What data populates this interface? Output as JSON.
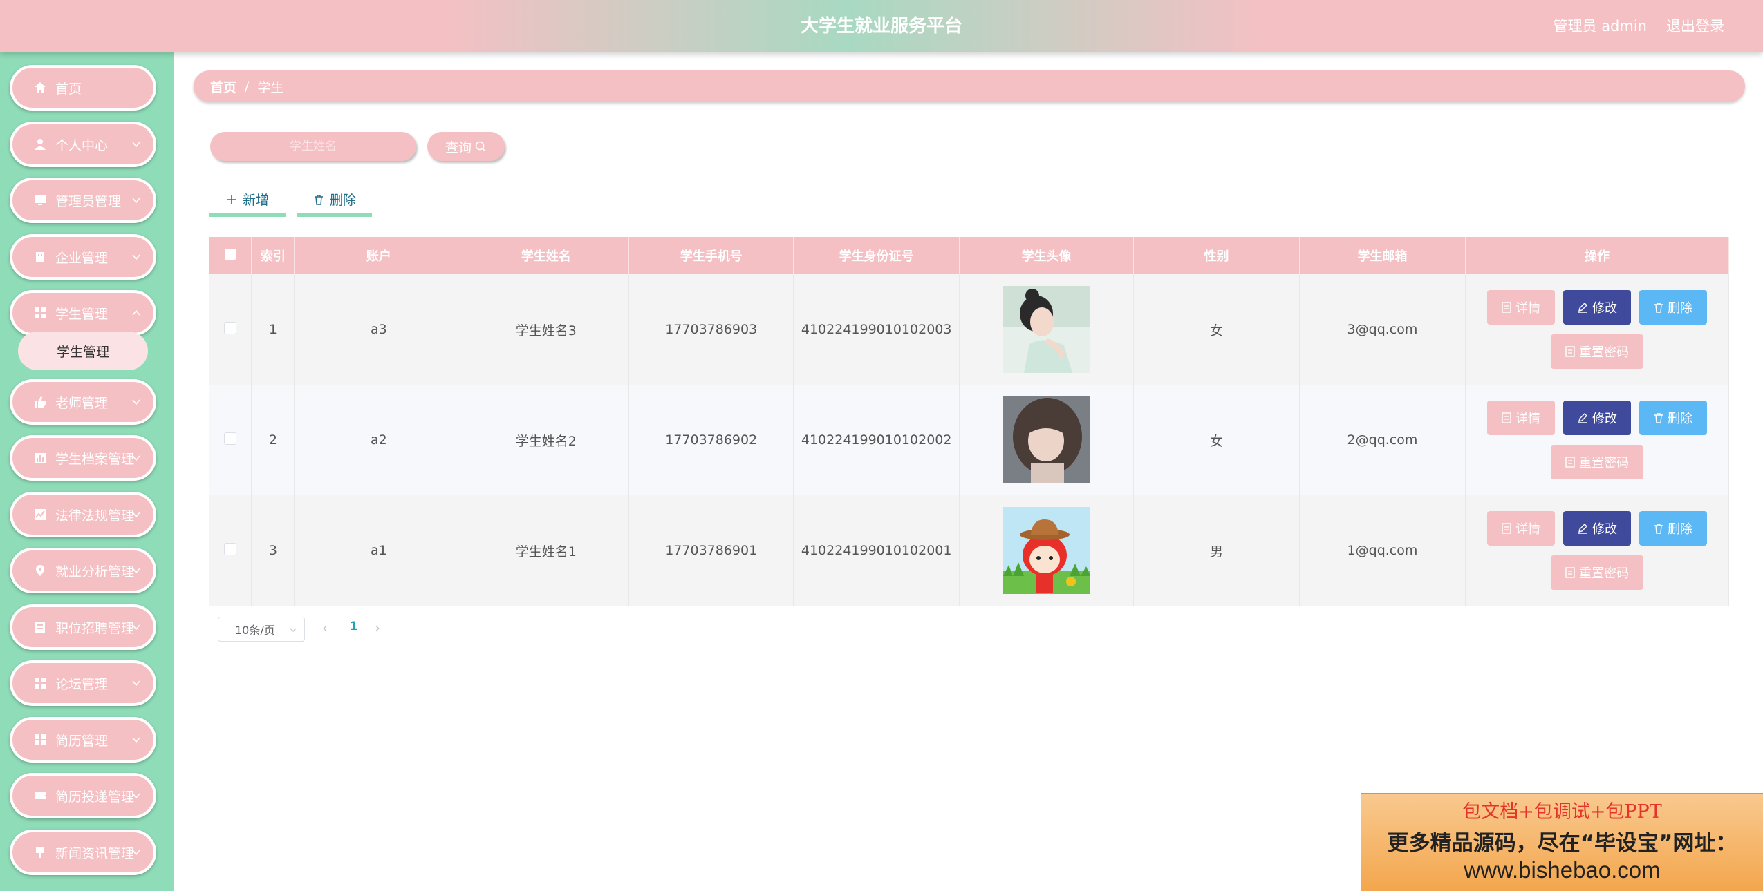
{
  "header": {
    "title": "大学生就业服务平台",
    "user": "管理员 admin",
    "logout": "退出登录"
  },
  "sidebar": {
    "items": [
      {
        "label": "首页",
        "icon": "home-icon"
      },
      {
        "label": "个人中心",
        "icon": "user-icon"
      },
      {
        "label": "管理员管理",
        "icon": "monitor-icon"
      },
      {
        "label": "企业管理",
        "icon": "building-icon"
      },
      {
        "label": "学生管理",
        "icon": "grid-icon"
      },
      {
        "label": "老师管理",
        "icon": "thumb-icon"
      },
      {
        "label": "学生档案管理",
        "icon": "chart-icon"
      },
      {
        "label": "法律法规管理",
        "icon": "trend-icon"
      },
      {
        "label": "就业分析管理",
        "icon": "location-icon"
      },
      {
        "label": "职位招聘管理",
        "icon": "list-icon"
      },
      {
        "label": "论坛管理",
        "icon": "grid-icon"
      },
      {
        "label": "简历管理",
        "icon": "grid-icon"
      },
      {
        "label": "简历投递管理",
        "icon": "ticket-icon"
      },
      {
        "label": "新闻资讯管理",
        "icon": "pin-icon"
      }
    ],
    "submenu": {
      "label": "学生管理"
    }
  },
  "breadcrumb": {
    "home": "首页",
    "separator": "/",
    "current": "学生"
  },
  "search": {
    "placeholder": "学生姓名",
    "button": "查询"
  },
  "actions": {
    "add": "新增",
    "delete": "删除"
  },
  "table": {
    "headers": [
      "索引",
      "账户",
      "学生姓名",
      "学生手机号",
      "学生身份证号",
      "学生头像",
      "性别",
      "学生邮箱",
      "操作"
    ],
    "rows": [
      {
        "index": "1",
        "account": "a3",
        "name": "学生姓名3",
        "phone": "17703786903",
        "id_card": "410224199010102003",
        "avatar": "woman-avatar",
        "gender": "女",
        "email": "3@qq.com"
      },
      {
        "index": "2",
        "account": "a2",
        "name": "学生姓名2",
        "phone": "17703786902",
        "id_card": "410224199010102002",
        "avatar": "girl-avatar",
        "gender": "女",
        "email": "2@qq.com"
      },
      {
        "index": "3",
        "account": "a1",
        "name": "学生姓名1",
        "phone": "17703786901",
        "id_card": "410224199010102001",
        "avatar": "cartoon-avatar",
        "gender": "男",
        "email": "1@qq.com"
      }
    ],
    "ops": {
      "detail": "详情",
      "edit": "修改",
      "delete": "删除",
      "reset": "重置密码"
    }
  },
  "pagination": {
    "page_size": "10条/页",
    "current_page": "1"
  },
  "banner": {
    "line1": "包文档+包调试+包PPT",
    "line2": "更多精品源码，尽在“毕设宝”网址：",
    "line3": "www.bishebao.com"
  },
  "colors": {
    "accent_pink": "#f5c0c4",
    "accent_green": "#8fdcb8",
    "edit_blue": "#3f4a9c",
    "delete_blue": "#5bb8f5"
  }
}
